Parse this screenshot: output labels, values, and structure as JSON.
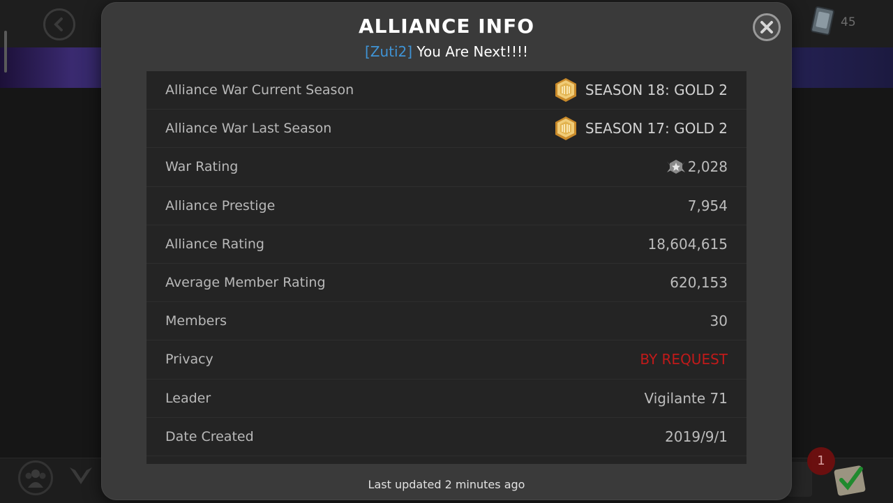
{
  "modal": {
    "title": "ALLIANCE INFO",
    "subtitle_tag": "[Zuti2]",
    "subtitle_text": "You Are Next!!!!",
    "footer": "Last updated 2 minutes ago"
  },
  "rows": [
    {
      "label": "Alliance War Current Season",
      "value": "SEASON 18: GOLD 2"
    },
    {
      "label": "Alliance War Last Season",
      "value": "SEASON 17: GOLD 2"
    },
    {
      "label": "War Rating",
      "value": "2,028"
    },
    {
      "label": "Alliance Prestige",
      "value": "7,954"
    },
    {
      "label": "Alliance Rating",
      "value": "18,604,615"
    },
    {
      "label": "Average Member Rating",
      "value": "620,153"
    },
    {
      "label": "Members",
      "value": "30"
    },
    {
      "label": "Privacy",
      "value": "BY REQUEST"
    },
    {
      "label": "Leader",
      "value": "Vigilante 71"
    },
    {
      "label": "Date Created",
      "value": "2019/9/1"
    }
  ],
  "background": {
    "card_count": "45",
    "notification_count": "1"
  },
  "colors": {
    "tag_blue": "#3f94d6",
    "privacy_red": "#c11a1a",
    "gold": "#d9a847"
  },
  "icons": [
    "back-arrow-icon",
    "close-icon",
    "gold-tier-icon",
    "war-rating-icon",
    "card-icon",
    "alliance-icon",
    "war-icon",
    "checkmark-icon"
  ]
}
